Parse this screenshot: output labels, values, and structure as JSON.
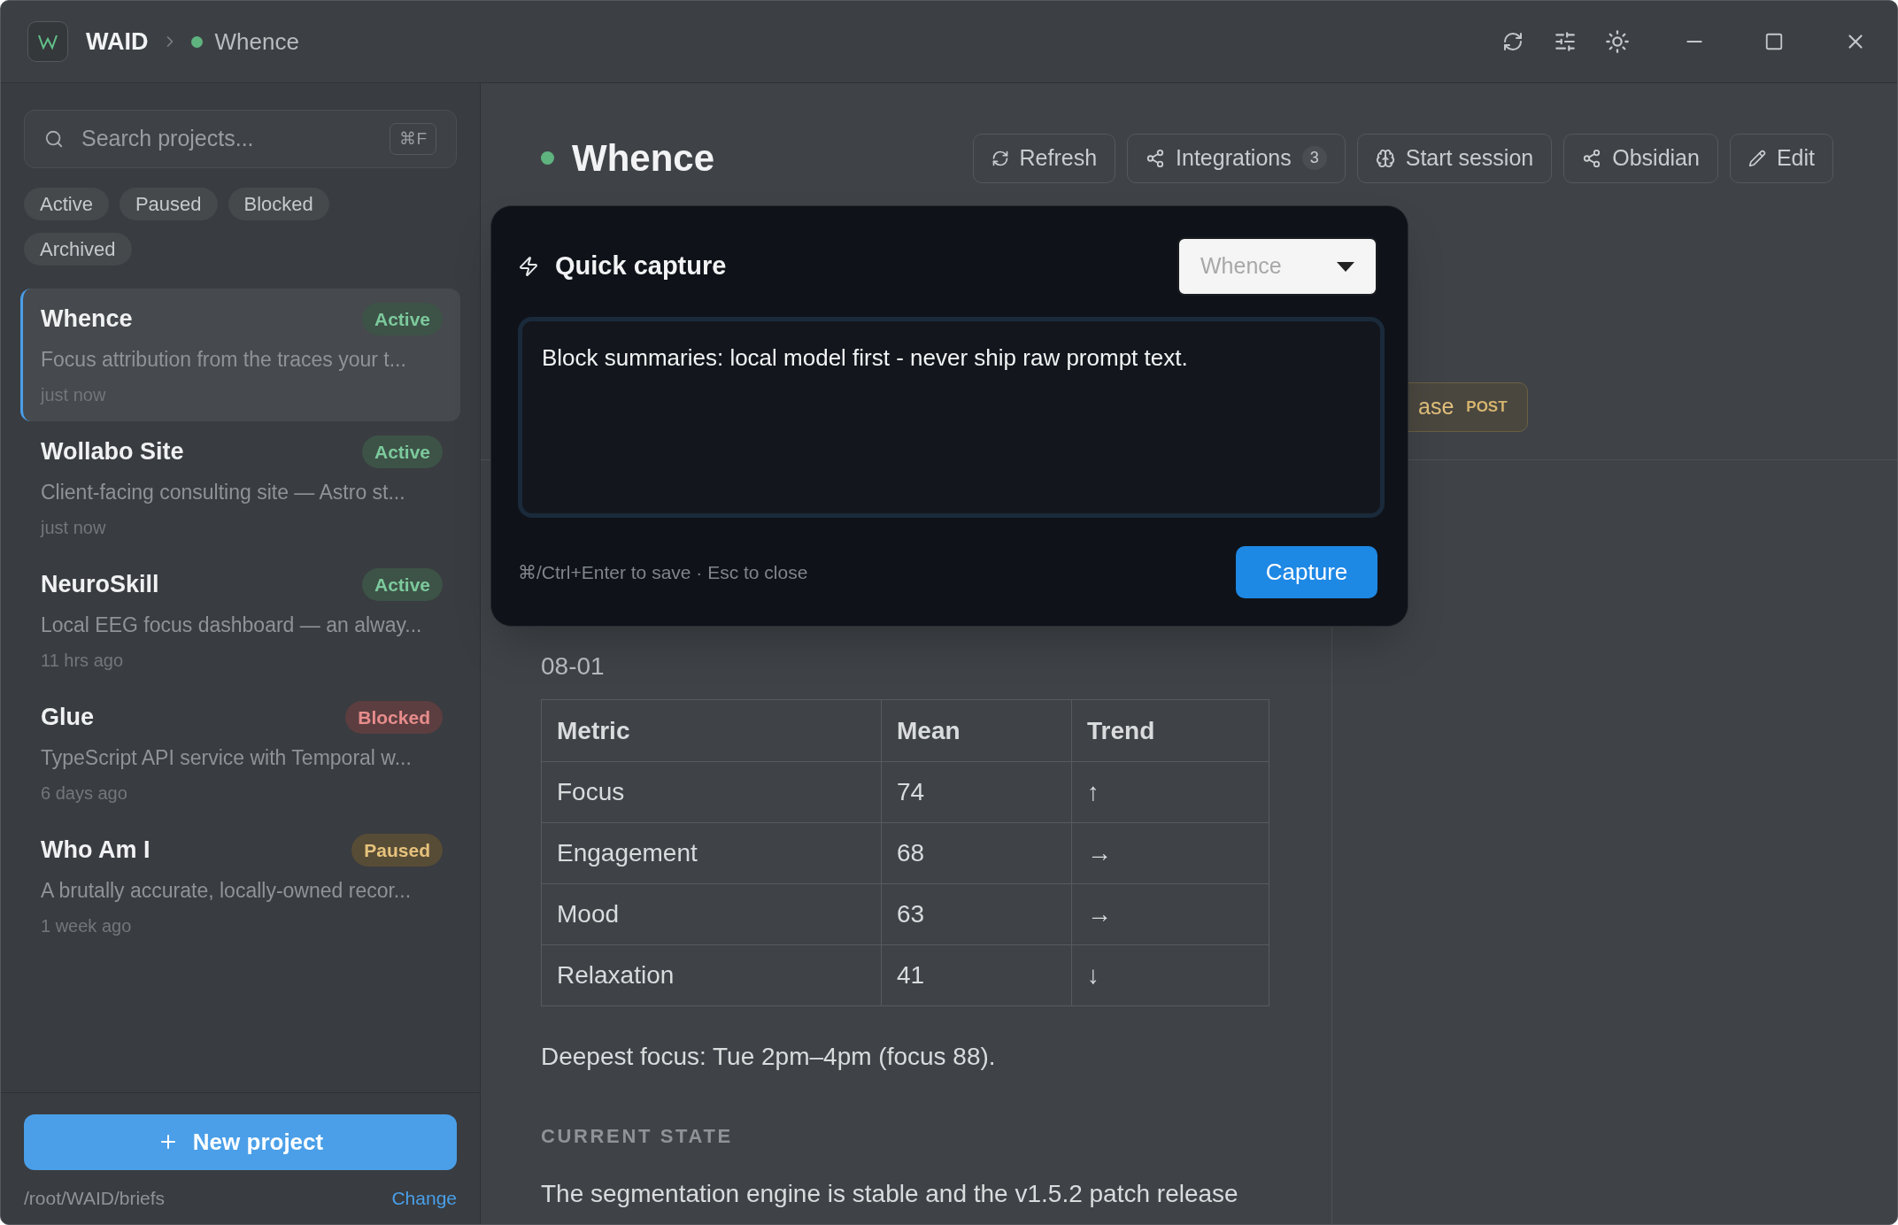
{
  "titlebar": {
    "app_name": "WAID",
    "breadcrumb": "Whence"
  },
  "search": {
    "placeholder": "Search projects...",
    "shortcut": "⌘F"
  },
  "filters": [
    {
      "label": "Active",
      "selected": false
    },
    {
      "label": "Paused",
      "selected": false
    },
    {
      "label": "Blocked",
      "selected": false
    },
    {
      "label": "Archived",
      "selected": false
    }
  ],
  "projects": [
    {
      "name": "Whence",
      "status": "Active",
      "kind": "active",
      "description": "Focus attribution from the traces your t...",
      "updated": "just now",
      "selected": true
    },
    {
      "name": "Wollabo Site",
      "status": "Active",
      "kind": "active",
      "description": "Client-facing consulting site — Astro st...",
      "updated": "just now",
      "selected": false
    },
    {
      "name": "NeuroSkill",
      "status": "Active",
      "kind": "active",
      "description": "Local EEG focus dashboard — an alway...",
      "updated": "11 hrs ago",
      "selected": false
    },
    {
      "name": "Glue",
      "status": "Blocked",
      "kind": "blocked",
      "description": "TypeScript API service with Temporal w...",
      "updated": "6 days ago",
      "selected": false
    },
    {
      "name": "Who Am I",
      "status": "Paused",
      "kind": "paused",
      "description": "A brutally accurate, locally-owned recor...",
      "updated": "1 week ago",
      "selected": false
    }
  ],
  "new_project": "New project",
  "footer": {
    "path": "/root/WAID/briefs",
    "change": "Change"
  },
  "project_header": {
    "title": "Whence",
    "actions": [
      {
        "label": "Refresh",
        "kind": "refresh"
      },
      {
        "label": "Integrations",
        "kind": "integrations",
        "count": "3"
      },
      {
        "label": "Start session",
        "kind": "session"
      },
      {
        "label": "Obsidian",
        "kind": "integrations"
      },
      {
        "label": "Edit",
        "kind": "edit"
      }
    ]
  },
  "partial_action": {
    "label": "ase",
    "badge": "POST"
  },
  "date": "08-01",
  "table": {
    "columns": [
      "Metric",
      "Mean",
      "Trend"
    ],
    "rows": [
      [
        "Focus",
        "74",
        "↑"
      ],
      [
        "Engagement",
        "68",
        "→"
      ],
      [
        "Mood",
        "63",
        "→"
      ],
      [
        "Relaxation",
        "41",
        "↓"
      ]
    ]
  },
  "summary": "Deepest focus: Tue 2pm–4pm (focus 88).",
  "section_heading": "CURRENT STATE",
  "body": "The segmentation engine is stable and the v1.5.2 patch release",
  "quick_capture": {
    "title": "Quick capture",
    "project": "Whence",
    "text": "Block summaries: local model first - never ship raw prompt text.",
    "hint": "⌘/Ctrl+Enter to save · Esc to close",
    "button": "Capture"
  }
}
